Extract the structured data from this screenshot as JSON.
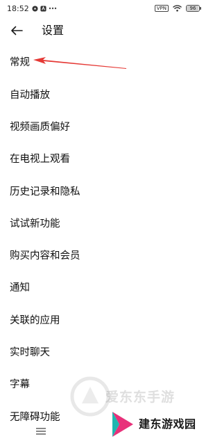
{
  "status_bar": {
    "time": "18:52",
    "vpn": "VPN",
    "battery": "96",
    "battery_level_percent": 96
  },
  "header": {
    "title": "设置"
  },
  "settings": {
    "items": [
      {
        "label": "常规"
      },
      {
        "label": "自动播放"
      },
      {
        "label": "视频画质偏好"
      },
      {
        "label": "在电视上观看"
      },
      {
        "label": "历史记录和隐私"
      },
      {
        "label": "试试新功能"
      },
      {
        "label": "购买内容和会员"
      },
      {
        "label": "通知"
      },
      {
        "label": "关联的应用"
      },
      {
        "label": "实时聊天"
      },
      {
        "label": "字幕"
      },
      {
        "label": "无障碍功能"
      }
    ]
  },
  "watermark": {
    "faded_text": "爱东东手游",
    "brand_text": "建东游戏园"
  },
  "colors": {
    "annotation_arrow": "#e53935",
    "text_primary": "#0f0f0f",
    "brand_pink": "#e8317a",
    "brand_teal": "#1fb6b0"
  }
}
